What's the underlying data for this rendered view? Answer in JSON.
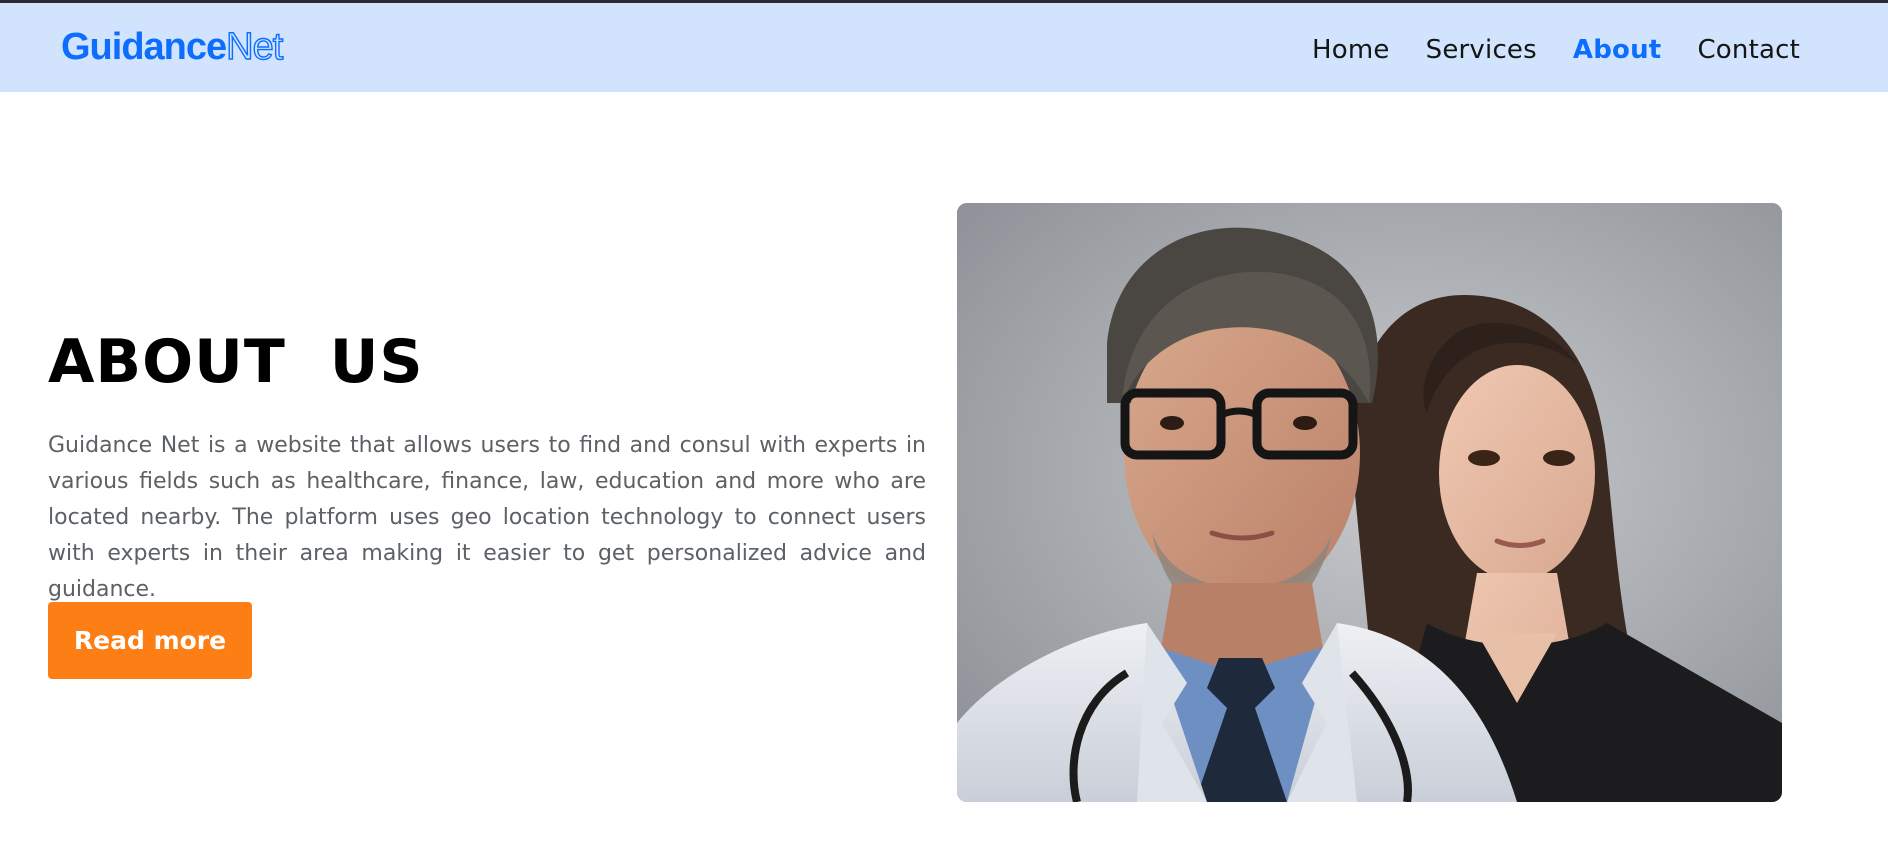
{
  "header": {
    "logo_part1": "Guidance",
    "logo_part2": "Net",
    "nav": [
      {
        "label": "Home",
        "active": false
      },
      {
        "label": "Services",
        "active": false
      },
      {
        "label": "About",
        "active": true
      },
      {
        "label": "Contact",
        "active": false
      }
    ]
  },
  "about": {
    "title": "ABOUT US",
    "text": "Guidance Net is a website that allows users to find and consul with experts in various fields such as healthcare, finance, law, education and more who are located nearby. The platform uses geo location technology to connect users with experts in their area making it easier to get personalized advice and guidance.",
    "button_label": "Read more"
  },
  "colors": {
    "navbar_bg": "#d1e3fd",
    "accent": "#0d6efd",
    "button": "#fd7e14",
    "body_text": "#5c6166"
  },
  "image": {
    "alt_semantic": "portrait-photo-doctor-and-woman"
  }
}
